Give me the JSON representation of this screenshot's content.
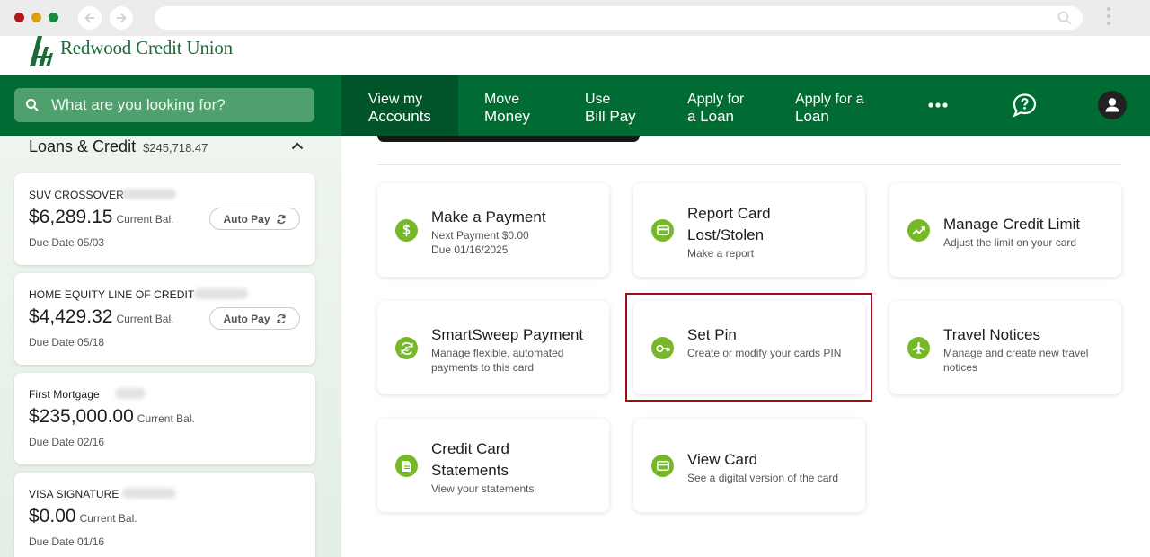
{
  "browser": {
    "back_icon": "arrow-left-icon",
    "forward_icon": "arrow-right-icon",
    "url": ""
  },
  "brand": {
    "name": "Redwood Credit Union",
    "color": "#006b33",
    "accent": "#76b82a",
    "highlight": "#9c0f14"
  },
  "nav": {
    "search_placeholder": "What are you looking for?",
    "items": [
      {
        "line1": "View my",
        "line2": "Accounts",
        "active": true
      },
      {
        "line1": "Move",
        "line2": "Money",
        "active": false
      },
      {
        "line1": "Use",
        "line2": "Bill Pay",
        "active": false
      },
      {
        "line1": "Apply for",
        "line2": "a Loan",
        "active": false
      },
      {
        "line1": "Apply for a",
        "line2": "Loan",
        "active": false
      }
    ],
    "more_icon": "more-dots-icon",
    "help_icon": "help-chat-icon",
    "profile_icon": "user-avatar-icon"
  },
  "sidebar": {
    "title": "Loans & Credit",
    "total": "$245,718.47",
    "accounts": [
      {
        "name": "SUV CROSSOVER",
        "balance": "$6,289.15",
        "balance_note": "Current Bal.",
        "due": "Due Date 05/03",
        "autopay": "Auto Pay"
      },
      {
        "name": "HOME EQUITY LINE OF CREDIT",
        "balance": "$4,429.32",
        "balance_note": "Current Bal.",
        "due": "Due Date 05/18",
        "autopay": "Auto Pay"
      },
      {
        "name": "First Mortgage",
        "balance": "$235,000.00",
        "balance_note": "Current Bal.",
        "due": "Due Date 02/16"
      },
      {
        "name": "VISA SIGNATURE",
        "balance": "$0.00",
        "balance_note": "Current Bal.",
        "due": "Due Date 01/16"
      }
    ]
  },
  "actions": [
    {
      "title": "Make a Payment",
      "lines": [
        "Next Payment $0.00",
        "Due 01/16/2025"
      ],
      "icon": "dollar-icon"
    },
    {
      "title": "Report Card Lost/Stolen",
      "lines": [
        "Make a report"
      ],
      "icon": "card-icon"
    },
    {
      "title": "Manage Credit Limit",
      "lines": [
        "Adjust the limit on your card"
      ],
      "icon": "trend-icon"
    },
    {
      "title": "SmartSweep Payment",
      "lines": [
        "Manage flexible, automated payments to this card"
      ],
      "icon": "sweep-icon"
    },
    {
      "title": "Set Pin",
      "lines": [
        "Create or modify your cards PIN"
      ],
      "icon": "key-icon"
    },
    {
      "title": "Travel Notices",
      "lines": [
        "Manage and create new travel notices"
      ],
      "icon": "airplane-icon"
    },
    {
      "title": "Credit Card Statements",
      "lines": [
        "View your statements"
      ],
      "icon": "document-icon"
    },
    {
      "title": "View Card",
      "lines": [
        "See a digital version of the card"
      ],
      "icon": "card-icon"
    }
  ]
}
